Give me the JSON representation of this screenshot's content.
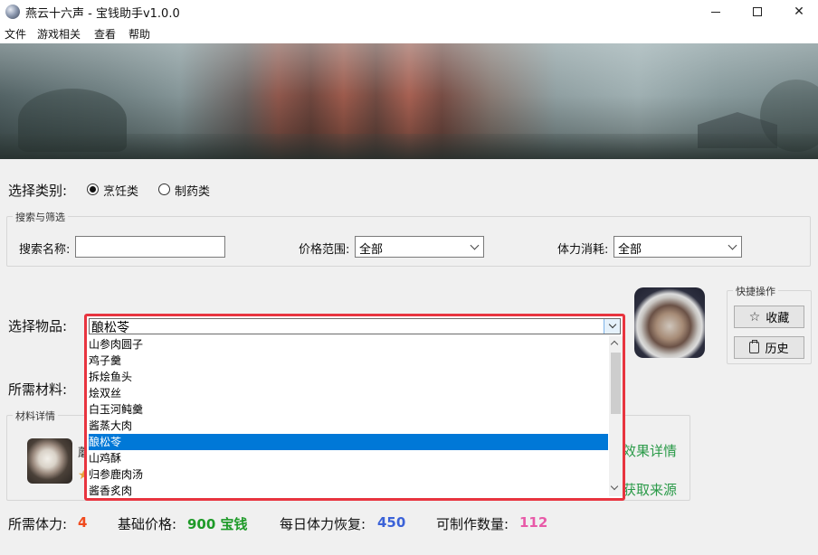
{
  "window": {
    "title": "燕云十六声 - 宝钱助手v1.0.0",
    "min_label": "─",
    "max_label": "☐",
    "close_label": "✕"
  },
  "menu": [
    "文件",
    "游戏相关",
    "查看",
    "帮助"
  ],
  "category": {
    "label": "选择类别:",
    "options": [
      "烹饪类",
      "制药类"
    ],
    "selected": "烹饪类"
  },
  "filter": {
    "group_title": "搜索与筛选",
    "search_label": "搜索名称:",
    "search_value": "",
    "price_label": "价格范围:",
    "price_value": "全部",
    "stamina_label": "体力消耗:",
    "stamina_value": "全部"
  },
  "item_select": {
    "label": "选择物品:",
    "current": "酿松苓",
    "options": [
      "山参肉圆子",
      "鸡子羹",
      "拆烩鱼头",
      "烩双丝",
      "白玉河鲀羹",
      "酱蒸大肉",
      "酿松苓",
      "山鸡酥",
      "归参鹿肉汤",
      "酱香炙肉"
    ],
    "selected_index": 6
  },
  "quick_ops": {
    "title": "快捷操作",
    "favorite_label": "收藏",
    "history_label": "历史"
  },
  "materials": {
    "label": "所需材料:",
    "group_title": "材料详情",
    "partial_initial": "蘑",
    "effect_link": "效果详情",
    "source_link": "获取来源"
  },
  "stats": {
    "stamina_label": "所需体力:",
    "stamina_value": "4",
    "price_label": "基础价格:",
    "price_value": "900 宝钱",
    "daily_label": "每日体力恢复:",
    "daily_value": "450",
    "count_label": "可制作数量:",
    "count_value": "112"
  },
  "colors": {
    "stamina": "#f04a1e",
    "price": "#1e9a28",
    "daily": "#3b62d8",
    "count": "#e85aa8",
    "link": "#2a9a48",
    "highlight_border": "#e8343f",
    "selection": "#0078d7"
  }
}
